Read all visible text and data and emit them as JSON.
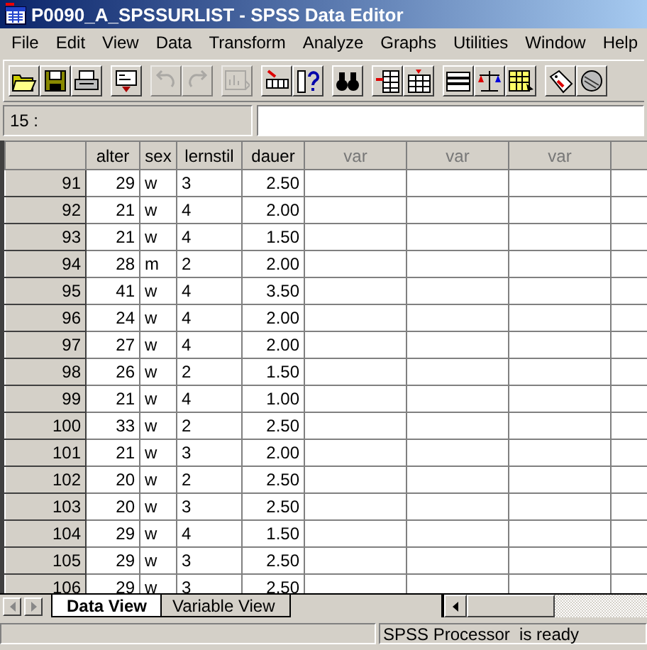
{
  "window": {
    "title": "P0090_A_SPSSURLIST - SPSS Data Editor"
  },
  "menu": [
    "File",
    "Edit",
    "View",
    "Data",
    "Transform",
    "Analyze",
    "Graphs",
    "Utilities",
    "Window",
    "Help"
  ],
  "toolbar": [
    {
      "kind": "open",
      "disabled": false
    },
    {
      "kind": "save",
      "disabled": false
    },
    {
      "kind": "print",
      "disabled": false
    },
    {
      "kind": "dialog",
      "disabled": false
    },
    {
      "kind": "undo",
      "disabled": true
    },
    {
      "kind": "redo",
      "disabled": true
    },
    {
      "kind": "chart",
      "disabled": true
    },
    {
      "kind": "goto",
      "disabled": false
    },
    {
      "kind": "varinfo",
      "disabled": false
    },
    {
      "kind": "find",
      "disabled": false
    },
    {
      "kind": "insertcase",
      "disabled": false
    },
    {
      "kind": "insertvar",
      "disabled": false
    },
    {
      "kind": "split",
      "disabled": false
    },
    {
      "kind": "weight",
      "disabled": false
    },
    {
      "kind": "select",
      "disabled": false
    },
    {
      "kind": "labels",
      "disabled": false
    },
    {
      "kind": "sets",
      "disabled": false
    }
  ],
  "cell_editor": {
    "reference": "15 :"
  },
  "table": {
    "columns": [
      {
        "name": "alter",
        "right_aligned": true
      },
      {
        "name": "sex",
        "right_aligned": false
      },
      {
        "name": "lernstil",
        "right_aligned": false
      },
      {
        "name": "dauer",
        "right_aligned": true
      }
    ],
    "empty_columns": [
      "var",
      "var",
      "var"
    ],
    "rows": [
      {
        "case": "91",
        "values": [
          "29",
          "w",
          "3",
          "2.50"
        ]
      },
      {
        "case": "92",
        "values": [
          "21",
          "w",
          "4",
          "2.00"
        ]
      },
      {
        "case": "93",
        "values": [
          "21",
          "w",
          "4",
          "1.50"
        ]
      },
      {
        "case": "94",
        "values": [
          "28",
          "m",
          "2",
          "2.00"
        ]
      },
      {
        "case": "95",
        "values": [
          "41",
          "w",
          "4",
          "3.50"
        ]
      },
      {
        "case": "96",
        "values": [
          "24",
          "w",
          "4",
          "2.00"
        ]
      },
      {
        "case": "97",
        "values": [
          "27",
          "w",
          "4",
          "2.00"
        ]
      },
      {
        "case": "98",
        "values": [
          "26",
          "w",
          "2",
          "1.50"
        ]
      },
      {
        "case": "99",
        "values": [
          "21",
          "w",
          "4",
          "1.00"
        ]
      },
      {
        "case": "100",
        "values": [
          "33",
          "w",
          "2",
          "2.50"
        ]
      },
      {
        "case": "101",
        "values": [
          "21",
          "w",
          "3",
          "2.00"
        ]
      },
      {
        "case": "102",
        "values": [
          "20",
          "w",
          "2",
          "2.50"
        ]
      },
      {
        "case": "103",
        "values": [
          "20",
          "w",
          "3",
          "2.50"
        ]
      },
      {
        "case": "104",
        "values": [
          "29",
          "w",
          "4",
          "1.50"
        ]
      },
      {
        "case": "105",
        "values": [
          "29",
          "w",
          "3",
          "2.50"
        ]
      },
      {
        "case": "106",
        "values": [
          "29",
          "w",
          "3",
          "2.50"
        ]
      }
    ]
  },
  "tabs": [
    {
      "label": "Data View",
      "selected": true
    },
    {
      "label": "Variable View",
      "selected": false
    }
  ],
  "status_bar": {
    "message": "SPSS Processor  is ready"
  }
}
